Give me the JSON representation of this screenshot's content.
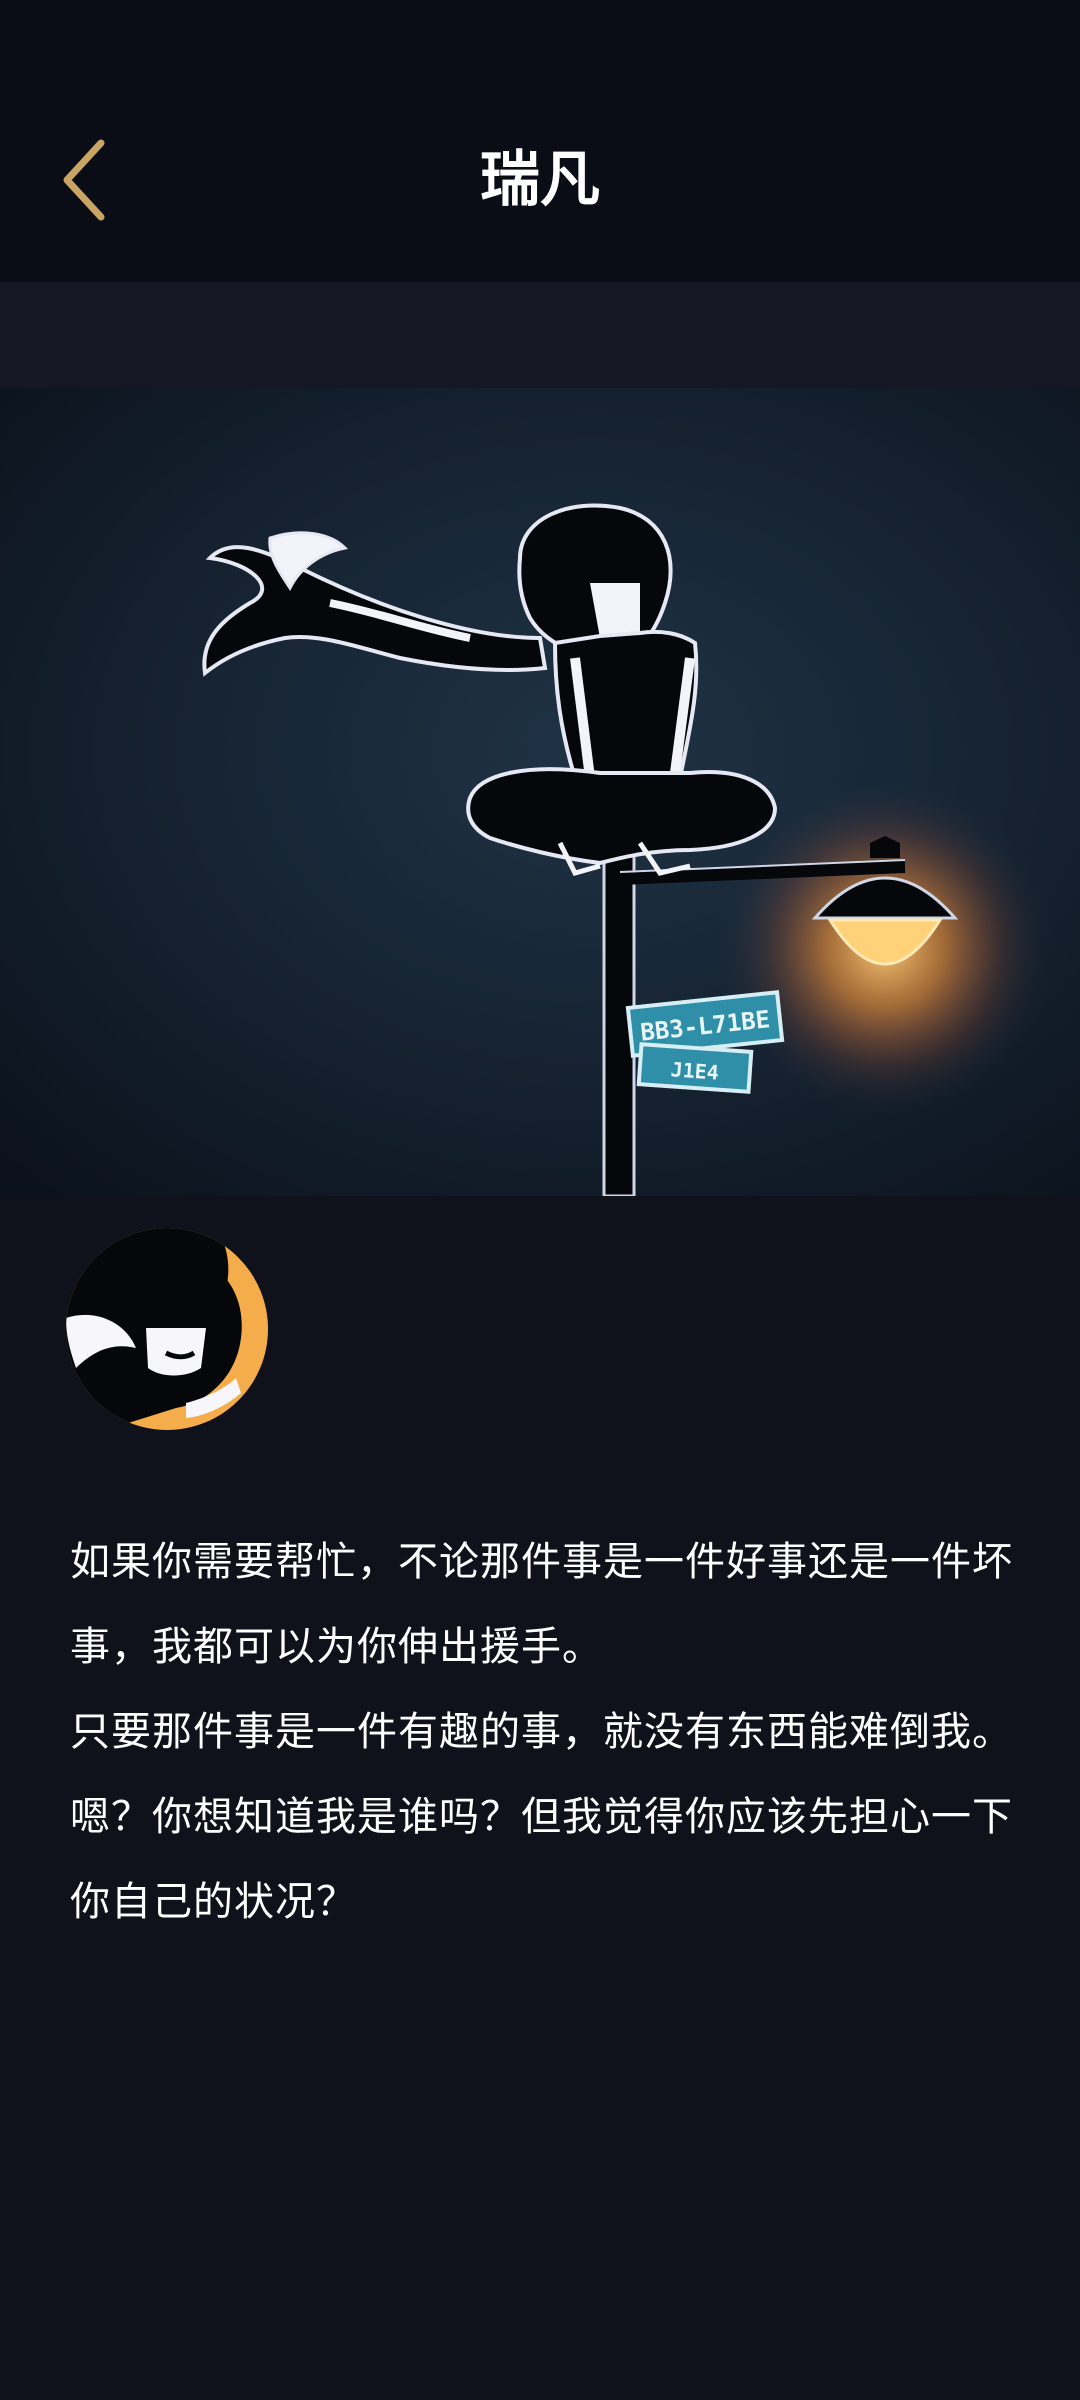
{
  "header": {
    "title": "瑞凡",
    "back_icon": "chevron-left-icon",
    "accent_color": "#c9a463"
  },
  "hero": {
    "sign_text_top": "BB3-L71BE",
    "sign_text_bottom": "J1E4"
  },
  "profile": {
    "avatar_icon": "character-avatar"
  },
  "bio": {
    "lines": [
      "如果你需要帮忙，不论那件事是一件好事还是一件坏事，我都可以为你伸出援手。",
      "只要那件事是一件有趣的事，就没有东西能难倒我。",
      "嗯？你想知道我是谁吗？但我觉得你应该先担心一下你自己的状况？"
    ]
  },
  "colors": {
    "background": "#0f111b",
    "header_bg": "#0b0d16",
    "band_bg": "#151824",
    "lamp_glow": "#ffb347",
    "sign_teal": "#2f8fa8"
  }
}
